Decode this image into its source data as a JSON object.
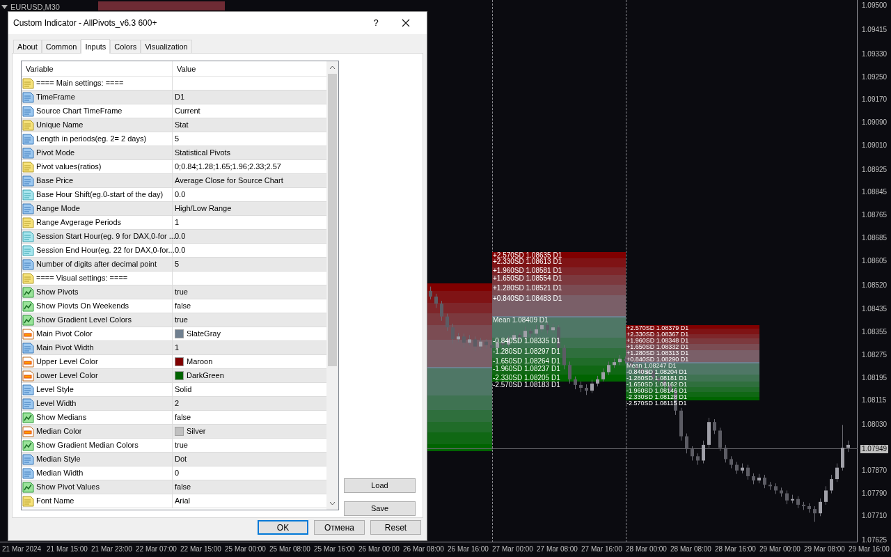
{
  "chart": {
    "symbol": "EURUSD,M30",
    "pivot_blocks": [
      {
        "labels": [
          {
            "text": "+2.570SD 1.08635 D1",
            "kind": "upper"
          },
          {
            "text": "+2.330SD 1.08613 D1",
            "kind": "upper"
          },
          {
            "text": "+1.960SD 1.08581 D1",
            "kind": "upper"
          },
          {
            "text": "+1.650SD 1.08554 D1",
            "kind": "upper"
          },
          {
            "text": "+1.280SD 1.08521 D1",
            "kind": "upper"
          },
          {
            "text": "+0.840SD 1.08483 D1",
            "kind": "upper"
          },
          {
            "text": "Mean 1.08409 D1",
            "kind": "mean"
          },
          {
            "text": "-0.840SD 1.08335 D1",
            "kind": "lower"
          },
          {
            "text": "-1.280SD 1.08297 D1",
            "kind": "lower"
          },
          {
            "text": "-1.650SD 1.08264 D1",
            "kind": "lower"
          },
          {
            "text": "-1.960SD 1.08237 D1",
            "kind": "lower"
          },
          {
            "text": "-2.330SD 1.08205 D1",
            "kind": "lower"
          },
          {
            "text": "-2.570SD 1.08183 D1",
            "kind": "lower"
          }
        ]
      },
      {
        "labels": [
          {
            "text": "+2.570SD 1.08379 D1",
            "kind": "upper"
          },
          {
            "text": "+2.330SD 1.08367 D1",
            "kind": "upper"
          },
          {
            "text": "+1.960SD 1.08348 D1",
            "kind": "upper"
          },
          {
            "text": "+1.650SD 1.08332 D1",
            "kind": "upper"
          },
          {
            "text": "+1.280SD 1.08313 D1",
            "kind": "upper"
          },
          {
            "text": "+0.840SD 1.08290 D1",
            "kind": "upper"
          },
          {
            "text": "Mean 1.08247 D1",
            "kind": "mean"
          },
          {
            "text": "-0.840SD 1.08204 D1",
            "kind": "lower"
          },
          {
            "text": "-1.280SD 1.08181 D1",
            "kind": "lower"
          },
          {
            "text": "-1.650SD 1.08162 D1",
            "kind": "lower"
          },
          {
            "text": "-1.960SD 1.08146 D1",
            "kind": "lower"
          },
          {
            "text": "-2.330SD 1.08128 D1",
            "kind": "lower"
          },
          {
            "text": "-2.570SD 1.08115 D1",
            "kind": "lower"
          }
        ]
      }
    ],
    "chart_data": {
      "type": "candlestick",
      "ylim": [
        1.07618,
        1.0952
      ],
      "yticks": [
        {
          "value": 1.095,
          "label": "1.09500"
        },
        {
          "value": 1.09415,
          "label": "1.09415"
        },
        {
          "value": 1.0933,
          "label": "1.09330"
        },
        {
          "value": 1.0925,
          "label": "1.09250"
        },
        {
          "value": 1.0917,
          "label": "1.09170"
        },
        {
          "value": 1.0909,
          "label": "1.09090"
        },
        {
          "value": 1.0901,
          "label": "1.09010"
        },
        {
          "value": 1.08925,
          "label": "1.08925"
        },
        {
          "value": 1.08845,
          "label": "1.08845"
        },
        {
          "value": 1.08765,
          "label": "1.08765"
        },
        {
          "value": 1.08685,
          "label": "1.08685"
        },
        {
          "value": 1.08605,
          "label": "1.08605"
        },
        {
          "value": 1.0852,
          "label": "1.08520"
        },
        {
          "value": 1.08435,
          "label": "1.08435"
        },
        {
          "value": 1.08355,
          "label": "1.08355"
        },
        {
          "value": 1.08275,
          "label": "1.08275"
        },
        {
          "value": 1.08195,
          "label": "1.08195"
        },
        {
          "value": 1.08115,
          "label": "1.08115"
        },
        {
          "value": 1.0803,
          "label": "1.08030"
        },
        {
          "value": 1.0787,
          "label": "1.07870"
        },
        {
          "value": 1.0779,
          "label": "1.07790"
        },
        {
          "value": 1.0771,
          "label": "1.07710"
        },
        {
          "value": 1.07625,
          "label": "1.07625"
        }
      ],
      "categories": [
        null,
        null,
        null,
        null,
        null,
        null,
        null,
        null,
        null,
        null,
        null,
        null,
        null,
        null,
        null,
        null,
        null,
        null,
        null,
        null,
        null,
        null,
        null,
        null,
        null,
        null,
        null,
        null,
        null,
        null,
        null,
        null,
        null,
        null,
        null,
        null,
        null,
        null,
        null,
        null,
        null,
        null,
        null,
        null,
        null,
        null,
        null,
        null,
        null,
        null,
        null,
        null,
        null,
        null,
        null,
        null,
        null,
        null,
        null,
        null,
        null,
        null,
        null,
        null,
        null,
        null,
        null,
        null,
        null,
        null,
        null,
        null,
        null,
        null,
        null,
        null
      ],
      "ohlc": [
        [
          1.085,
          1.08515,
          1.0847,
          1.0848
        ],
        [
          1.0848,
          1.0849,
          1.0844,
          1.08455
        ],
        [
          1.08455,
          1.08465,
          1.08395,
          1.0841
        ],
        [
          1.0841,
          1.0842,
          1.0836,
          1.08372
        ],
        [
          1.08372,
          1.08385,
          1.08315,
          1.0833
        ],
        [
          1.0833,
          1.08352,
          1.0832,
          1.0834
        ],
        [
          1.0834,
          1.0835,
          1.083,
          1.08318
        ],
        [
          1.08318,
          1.08345,
          1.0831,
          1.0833
        ],
        [
          1.0833,
          1.0834,
          1.0829,
          1.08305
        ],
        [
          1.08305,
          1.08335,
          1.08295,
          1.08322
        ],
        [
          1.08322,
          1.0833,
          1.08298,
          1.0831
        ],
        [
          1.0831,
          1.0832,
          1.08288,
          1.083
        ],
        [
          1.083,
          1.0833,
          1.08292,
          1.08318
        ],
        [
          1.08318,
          1.08325,
          1.083,
          1.08312
        ],
        [
          1.08312,
          1.08342,
          1.08305,
          1.0833
        ],
        [
          1.0833,
          1.08358,
          1.0832,
          1.08345
        ],
        [
          1.08345,
          1.08352,
          1.08325,
          1.08338
        ],
        [
          1.08338,
          1.08375,
          1.0833,
          1.0836
        ],
        [
          1.0836,
          1.08368,
          1.08338,
          1.0835
        ],
        [
          1.0835,
          1.0838,
          1.08342,
          1.08365
        ],
        [
          1.08365,
          1.08395,
          1.08355,
          1.0838
        ],
        [
          1.0838,
          1.08388,
          1.0835,
          1.08362
        ],
        [
          1.08362,
          1.08385,
          1.08352,
          1.08372
        ],
        [
          1.08372,
          1.0838,
          1.08285,
          1.083
        ],
        [
          1.083,
          1.0831,
          1.08225,
          1.0824
        ],
        [
          1.0824,
          1.08252,
          1.08175,
          1.0819
        ],
        [
          1.0819,
          1.082,
          1.08155,
          1.0817
        ],
        [
          1.0817,
          1.08182,
          1.08145,
          1.0816
        ],
        [
          1.0816,
          1.08172,
          1.08135,
          1.0815
        ],
        [
          1.0815,
          1.08188,
          1.08142,
          1.08175
        ],
        [
          1.08175,
          1.08202,
          1.08165,
          1.0819
        ],
        [
          1.0819,
          1.08228,
          1.08182,
          1.08215
        ],
        [
          1.08215,
          1.08252,
          1.08205,
          1.0824
        ],
        [
          1.0824,
          1.08262,
          1.0823,
          1.0825
        ],
        [
          1.0825,
          1.08275,
          1.0824,
          1.08262
        ],
        [
          1.08262,
          1.0827,
          1.08245,
          1.08255
        ],
        [
          1.08255,
          1.08265,
          1.08222,
          1.08235
        ],
        [
          1.08235,
          1.08245,
          1.08215,
          1.08226
        ],
        [
          1.08226,
          1.08236,
          1.08198,
          1.0821
        ],
        [
          1.0821,
          1.08232,
          1.082,
          1.0822
        ],
        [
          1.0822,
          1.0823,
          1.08182,
          1.08195
        ],
        [
          1.08195,
          1.08205,
          1.08172,
          1.08185
        ],
        [
          1.08185,
          1.08195,
          1.08158,
          1.0817
        ],
        [
          1.0817,
          1.0818,
          1.08138,
          1.0815
        ],
        [
          1.0815,
          1.0816,
          1.08065,
          1.0808
        ],
        [
          1.0808,
          1.0809,
          1.07975,
          1.0799
        ],
        [
          1.0799,
          1.08,
          1.0793,
          1.07945
        ],
        [
          1.07945,
          1.07955,
          1.07905,
          1.0792
        ],
        [
          1.0792,
          1.0793,
          1.0789,
          1.07905
        ],
        [
          1.07905,
          1.07975,
          1.07895,
          1.0796
        ],
        [
          1.0796,
          1.08055,
          1.0795,
          1.0804
        ],
        [
          1.0804,
          1.0805,
          1.07998,
          1.0801
        ],
        [
          1.0801,
          1.0802,
          1.07938,
          1.0795
        ],
        [
          1.0795,
          1.0796,
          1.07898,
          1.0791
        ],
        [
          1.0791,
          1.0792,
          1.07878,
          1.0789
        ],
        [
          1.0789,
          1.079,
          1.07858,
          1.0787
        ],
        [
          1.0787,
          1.07895,
          1.0786,
          1.0788
        ],
        [
          1.0788,
          1.0789,
          1.07838,
          1.0785
        ],
        [
          1.0785,
          1.0786,
          1.07822,
          1.07835
        ],
        [
          1.07835,
          1.07858,
          1.07825,
          1.07845
        ],
        [
          1.07845,
          1.07855,
          1.07808,
          1.0782
        ],
        [
          1.0782,
          1.0783,
          1.07802,
          1.07815
        ],
        [
          1.07815,
          1.07825,
          1.07788,
          1.078
        ],
        [
          1.078,
          1.0781,
          1.07778,
          1.0779
        ],
        [
          1.0779,
          1.078,
          1.07752,
          1.07765
        ],
        [
          1.07765,
          1.07785,
          1.07755,
          1.0777
        ],
        [
          1.0777,
          1.0778,
          1.07738,
          1.0775
        ],
        [
          1.0775,
          1.0776,
          1.07732,
          1.07745
        ],
        [
          1.07745,
          1.07755,
          1.07722,
          1.07735
        ],
        [
          1.07735,
          1.07745,
          1.0769,
          1.0772
        ],
        [
          1.0772,
          1.07772,
          1.0771,
          1.0776
        ],
        [
          1.0776,
          1.07815,
          1.0775,
          1.078
        ],
        [
          1.078,
          1.07855,
          1.0779,
          1.0784
        ],
        [
          1.0784,
          1.07895,
          1.0783,
          1.0788
        ],
        [
          1.0788,
          1.0803,
          1.0787,
          1.0795
        ],
        [
          1.0795,
          1.07975,
          1.07935,
          1.0796
        ]
      ]
    },
    "price_axis": {
      "current": "1.07949"
    },
    "time_axis": [
      "21 Mar 2024",
      "21 Mar 15:00",
      "21 Mar 23:00",
      "22 Mar 07:00",
      "22 Mar 15:00",
      "25 Mar 00:00",
      "25 Mar 08:00",
      "25 Mar 16:00",
      "26 Mar 00:00",
      "26 Mar 08:00",
      "26 Mar 16:00",
      "27 Mar 00:00",
      "27 Mar 08:00",
      "27 Mar 16:00",
      "28 Mar 00:00",
      "28 Mar 08:00",
      "28 Mar 16:00",
      "29 Mar 00:00",
      "29 Mar 08:00",
      "29 Mar 16:00"
    ]
  },
  "dialog": {
    "title": "Custom Indicator - AllPivots_v6.3 600+",
    "help": "?",
    "tabs": [
      {
        "label": "About",
        "selected": false
      },
      {
        "label": "Common",
        "selected": false
      },
      {
        "label": "Inputs",
        "selected": true
      },
      {
        "label": "Colors",
        "selected": false
      },
      {
        "label": "Visualization",
        "selected": false
      }
    ],
    "columns": [
      "Variable",
      "Value"
    ],
    "rows": [
      {
        "variable": "==== Main settings: ====",
        "value": "",
        "kind": "string"
      },
      {
        "variable": "TimeFrame",
        "value": "D1",
        "kind": "int"
      },
      {
        "variable": "Source Chart TimeFrame",
        "value": "Current",
        "kind": "int"
      },
      {
        "variable": "Unique Name",
        "value": "Stat",
        "kind": "string"
      },
      {
        "variable": "Length in periods(eg. 2= 2 days)",
        "value": "5",
        "kind": "int"
      },
      {
        "variable": "Pivot Mode",
        "value": "Statistical Pivots",
        "kind": "int"
      },
      {
        "variable": "Pivot values(ratios)",
        "value": "0;0.84;1.28;1.65;1.96;2.33;2.57",
        "kind": "string"
      },
      {
        "variable": "Base Price",
        "value": "Average Close for Source Chart",
        "kind": "int"
      },
      {
        "variable": "Base Hour Shift(eg.0-start of the day)",
        "value": "0.0",
        "kind": "double"
      },
      {
        "variable": "Range Mode",
        "value": "High/Low Range",
        "kind": "int"
      },
      {
        "variable": "Range Avgerage Periods",
        "value": "1",
        "kind": "string"
      },
      {
        "variable": "Session Start Hour(eg. 9 for DAX,0-for ...",
        "value": "0.0",
        "kind": "double"
      },
      {
        "variable": "Session End Hour(eg. 22 for DAX,0-for...",
        "value": "0.0",
        "kind": "double"
      },
      {
        "variable": "Number of digits after decimal point",
        "value": "5",
        "kind": "int"
      },
      {
        "variable": "==== Visual settings: ====",
        "value": "",
        "kind": "string"
      },
      {
        "variable": "Show Pivots",
        "value": "true",
        "kind": "bool"
      },
      {
        "variable": "Show Piovts On Weekends",
        "value": "false",
        "kind": "bool"
      },
      {
        "variable": "Show Gradient Level Colors",
        "value": "true",
        "kind": "bool"
      },
      {
        "variable": "Main Pivot Color",
        "value": "SlateGray",
        "kind": "color",
        "color": "#708090"
      },
      {
        "variable": "Main Pivot Width",
        "value": "1",
        "kind": "int"
      },
      {
        "variable": "Upper Level Color",
        "value": "Maroon",
        "kind": "color",
        "color": "#800000"
      },
      {
        "variable": "Lower Level Color",
        "value": "DarkGreen",
        "kind": "color",
        "color": "#006400"
      },
      {
        "variable": "Level Style",
        "value": "Solid",
        "kind": "int"
      },
      {
        "variable": "Level Width",
        "value": "2",
        "kind": "int"
      },
      {
        "variable": "Show Medians",
        "value": "false",
        "kind": "bool"
      },
      {
        "variable": "Median Color",
        "value": "Silver",
        "kind": "color",
        "color": "#c0c0c0"
      },
      {
        "variable": "Show Gradient Median Colors",
        "value": "true",
        "kind": "bool"
      },
      {
        "variable": "Median Style",
        "value": "Dot",
        "kind": "int"
      },
      {
        "variable": "Median Width",
        "value": "0",
        "kind": "int"
      },
      {
        "variable": "Show Pivot Values",
        "value": "false",
        "kind": "bool"
      },
      {
        "variable": "Font Name",
        "value": "Arial",
        "kind": "string"
      }
    ],
    "side_buttons": [
      "Load",
      "Save"
    ],
    "buttons": [
      {
        "label": "OK",
        "default": true
      },
      {
        "label": "Отмена",
        "default": false
      },
      {
        "label": "Reset",
        "default": false
      }
    ]
  }
}
